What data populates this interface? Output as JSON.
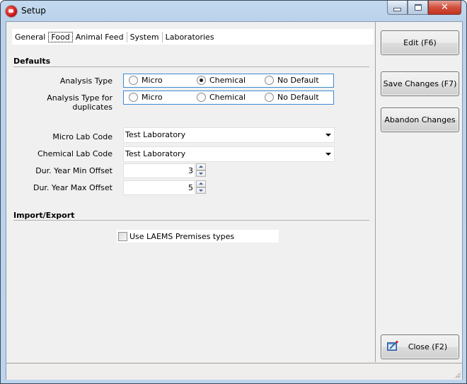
{
  "window": {
    "title": "Setup",
    "controls": {
      "minimize": "minimize",
      "maximize": "maximize",
      "close": "✕"
    }
  },
  "tabs": [
    {
      "label": "General",
      "active": false
    },
    {
      "label": "Food",
      "active": true
    },
    {
      "label": "Animal Feed",
      "active": false
    },
    {
      "label": "System",
      "active": false
    },
    {
      "label": "Laboratories",
      "active": false
    }
  ],
  "defaults": {
    "section_title": "Defaults",
    "analysis_type": {
      "label": "Analysis Type",
      "options": [
        "Micro",
        "Chemical",
        "No Default"
      ],
      "selected": "Chemical"
    },
    "analysis_type_duplicates": {
      "label": "Analysis Type for duplicates",
      "options": [
        "Micro",
        "Chemical",
        "No Default"
      ],
      "selected": null
    },
    "micro_lab_code": {
      "label": "Micro Lab Code",
      "value": "Test Laboratory"
    },
    "chemical_lab_code": {
      "label": "Chemical Lab Code",
      "value": "Test Laboratory"
    },
    "dur_year_min_offset": {
      "label": "Dur. Year Min Offset",
      "value": "3"
    },
    "dur_year_max_offset": {
      "label": "Dur. Year Max Offset",
      "value": "5"
    }
  },
  "import_export": {
    "section_title": "Import/Export",
    "use_laems": {
      "label": "Use LAEMS Premises types",
      "checked": false
    }
  },
  "side_buttons": {
    "edit": "Edit (F6)",
    "save": "Save Changes (F7)",
    "abandon": "Abandon Changes",
    "close": "Close (F2)"
  },
  "colors": {
    "radio_group_border": "#3c8ad4",
    "close_button": "#c2321f"
  }
}
